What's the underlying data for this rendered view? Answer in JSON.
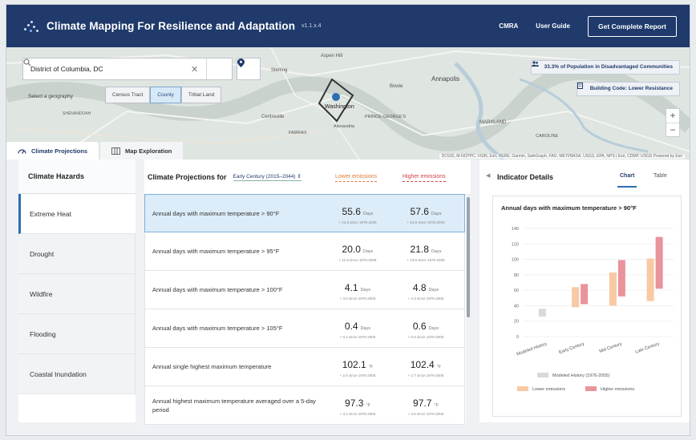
{
  "header": {
    "title": "Climate Mapping For Resilience and Adaptation",
    "version": "v1.1.x.4",
    "nav": [
      "CMRA",
      "User Guide"
    ],
    "report_button": "Get Complete Report"
  },
  "search": {
    "value": "District of Columbia, DC"
  },
  "geography": {
    "label": "Select a geography",
    "options": [
      "Census Tract",
      "County",
      "Tribal Land"
    ],
    "selected": "County"
  },
  "badges": {
    "disadvantaged": "33.3% of Population in Disadvantaged Communities",
    "building_code": "Building Code: Lower Resistance"
  },
  "map": {
    "places": [
      "Sterling",
      "Aspen Hill",
      "Annapolis",
      "Washington",
      "PRINCE GEORGE'S",
      "FAIRFAX",
      "Centreville",
      "Alexandria",
      "MARYLAND",
      "CAROLINE",
      "Bowie",
      "SHENANDOAH"
    ],
    "attribution": "DCGIS, M-NCPPC, VGIN, Esri, HERE, Garmin, SafeGraph, FAO, METI/NASA, USGS, EPA, NPS | Esri, CDMP, USGS     Powered by Esri",
    "zoom_in": "+",
    "zoom_out": "−"
  },
  "tabs": [
    {
      "label": "Climate Projections",
      "active": true
    },
    {
      "label": "Map Exploration",
      "active": false
    }
  ],
  "hazards": {
    "title": "Climate Hazards",
    "items": [
      "Extreme Heat",
      "Drought",
      "Wildfire",
      "Flooding",
      "Coastal Inundation"
    ],
    "selected": "Extreme Heat"
  },
  "projections": {
    "title": "Climate Projections for",
    "period": "Early Century (2015–2044)",
    "lower_label": "Lower emissions",
    "higher_label": "Higher emissions",
    "rows": [
      {
        "label": "Annual days with maximum temperature > 90°F",
        "low": "55.6",
        "low_unit": "Days",
        "low_delta": "+ 22.8 since 1976-2005",
        "high": "57.6",
        "high_unit": "Days",
        "high_delta": "+ 24.8 since 1976-2005"
      },
      {
        "label": "Annual days with maximum temperature > 95°F",
        "low": "20.0",
        "low_unit": "Days",
        "low_delta": "+ 11.8 since 1976-2005",
        "high": "21.8",
        "high_unit": "Days",
        "high_delta": "+ 13.6 since 1976-2005"
      },
      {
        "label": "Annual days with maximum temperature > 100°F",
        "low": "4.1",
        "low_unit": "Days",
        "low_delta": "+ 3.6 since 1976-2005",
        "high": "4.8",
        "high_unit": "Days",
        "high_delta": "+ 4.3 since 1976-2005"
      },
      {
        "label": "Annual days with maximum temperature > 105°F",
        "low": "0.4",
        "low_unit": "Days",
        "low_delta": "+ 0.4 since 1976-2005",
        "high": "0.6",
        "high_unit": "Days",
        "high_delta": "+ 0.6 since 1976-2005"
      },
      {
        "label": "Annual single highest maximum temperature",
        "low": "102.1",
        "low_unit": "°F",
        "low_delta": "+ 2.6 since 1976-2005",
        "high": "102.4",
        "high_unit": "°F",
        "high_delta": "+ 2.7 since 1976-2005"
      },
      {
        "label": "Annual highest maximum temperature averaged over a 5-day period",
        "low": "97.3",
        "low_unit": "°F",
        "low_delta": "+ 3.2 since 1976-2005",
        "high": "97.7",
        "high_unit": "°F",
        "high_delta": "+ 3.6 since 1976-2005"
      }
    ]
  },
  "details": {
    "title": "Indicator Details",
    "tab_chart": "Chart",
    "tab_table": "Table",
    "chart_title": "Annual days with maximum temperature > 90°F"
  },
  "chart_data": {
    "type": "bar",
    "title": "Annual days with maximum temperature > 90°F",
    "categories": [
      "Modeled History",
      "Early Century",
      "Mid Century",
      "Late Century"
    ],
    "ylim": [
      0,
      140
    ],
    "yticks": [
      0,
      20,
      40,
      60,
      80,
      100,
      120,
      140
    ],
    "series": [
      {
        "name": "Modeled History (1976-2005)",
        "color": "#d9d9d9",
        "ranges": [
          [
            26,
            36
          ],
          null,
          null,
          null
        ]
      },
      {
        "name": "Lower emissions",
        "color": "#f8c9a3",
        "ranges": [
          null,
          [
            38,
            64
          ],
          [
            40,
            83
          ],
          [
            46,
            101
          ]
        ]
      },
      {
        "name": "Higher emissions",
        "color": "#e9939b",
        "ranges": [
          null,
          [
            42,
            68
          ],
          [
            52,
            99
          ],
          [
            62,
            129
          ]
        ]
      }
    ],
    "legend": "bottom"
  }
}
